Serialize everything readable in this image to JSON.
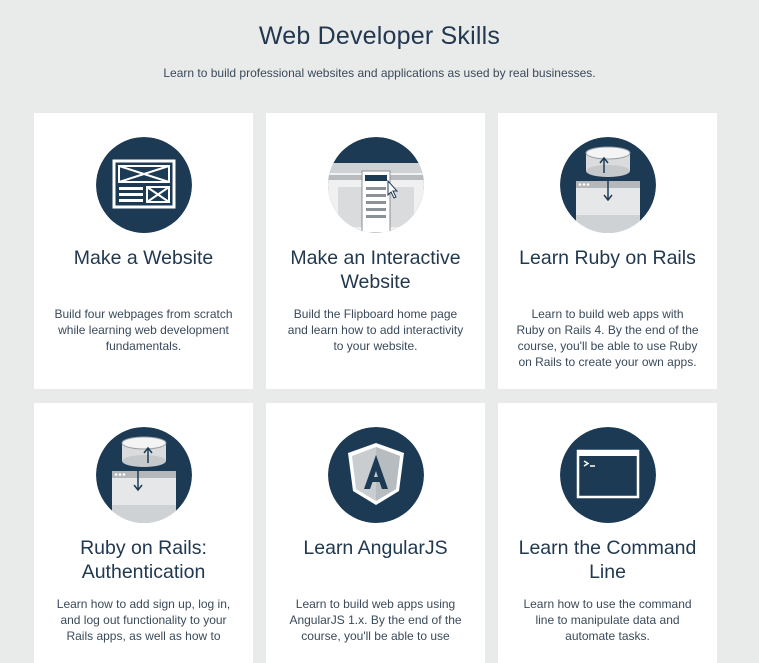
{
  "header": {
    "title": "Web Developer Skills",
    "subtitle": "Learn to build professional websites and applications as used by real businesses."
  },
  "cards": [
    {
      "title": "Make a Website",
      "description": "Build four webpages from scratch while learning web development fundamentals.",
      "icon": "website-wireframe-icon"
    },
    {
      "title": "Make an Interactive Website",
      "description": "Build the Flipboard home page and learn how to add interactivity to your website.",
      "icon": "interactive-website-icon"
    },
    {
      "title": "Learn Ruby on Rails",
      "description": "Learn to build web apps with Ruby on Rails 4. By the end of the course, you'll be able to use Ruby on Rails to create your own apps.",
      "icon": "database-sync-icon"
    },
    {
      "title": "Ruby on Rails: Authentication",
      "description": "Learn how to add sign up, log in, and log out functionality to your Rails apps, as well as how to",
      "icon": "database-sync-icon"
    },
    {
      "title": "Learn AngularJS",
      "description": "Learn to build web apps using AngularJS 1.x. By the end of the course, you'll be able to use",
      "icon": "angular-shield-icon"
    },
    {
      "title": "Learn the Command Line",
      "description": "Learn how to use the command line to manipulate data and automate tasks.",
      "icon": "terminal-window-icon"
    }
  ],
  "colors": {
    "background": "#e9eaea",
    "card": "#ffffff",
    "icon_circle": "#1d3a55",
    "text_dark": "#22384f"
  }
}
